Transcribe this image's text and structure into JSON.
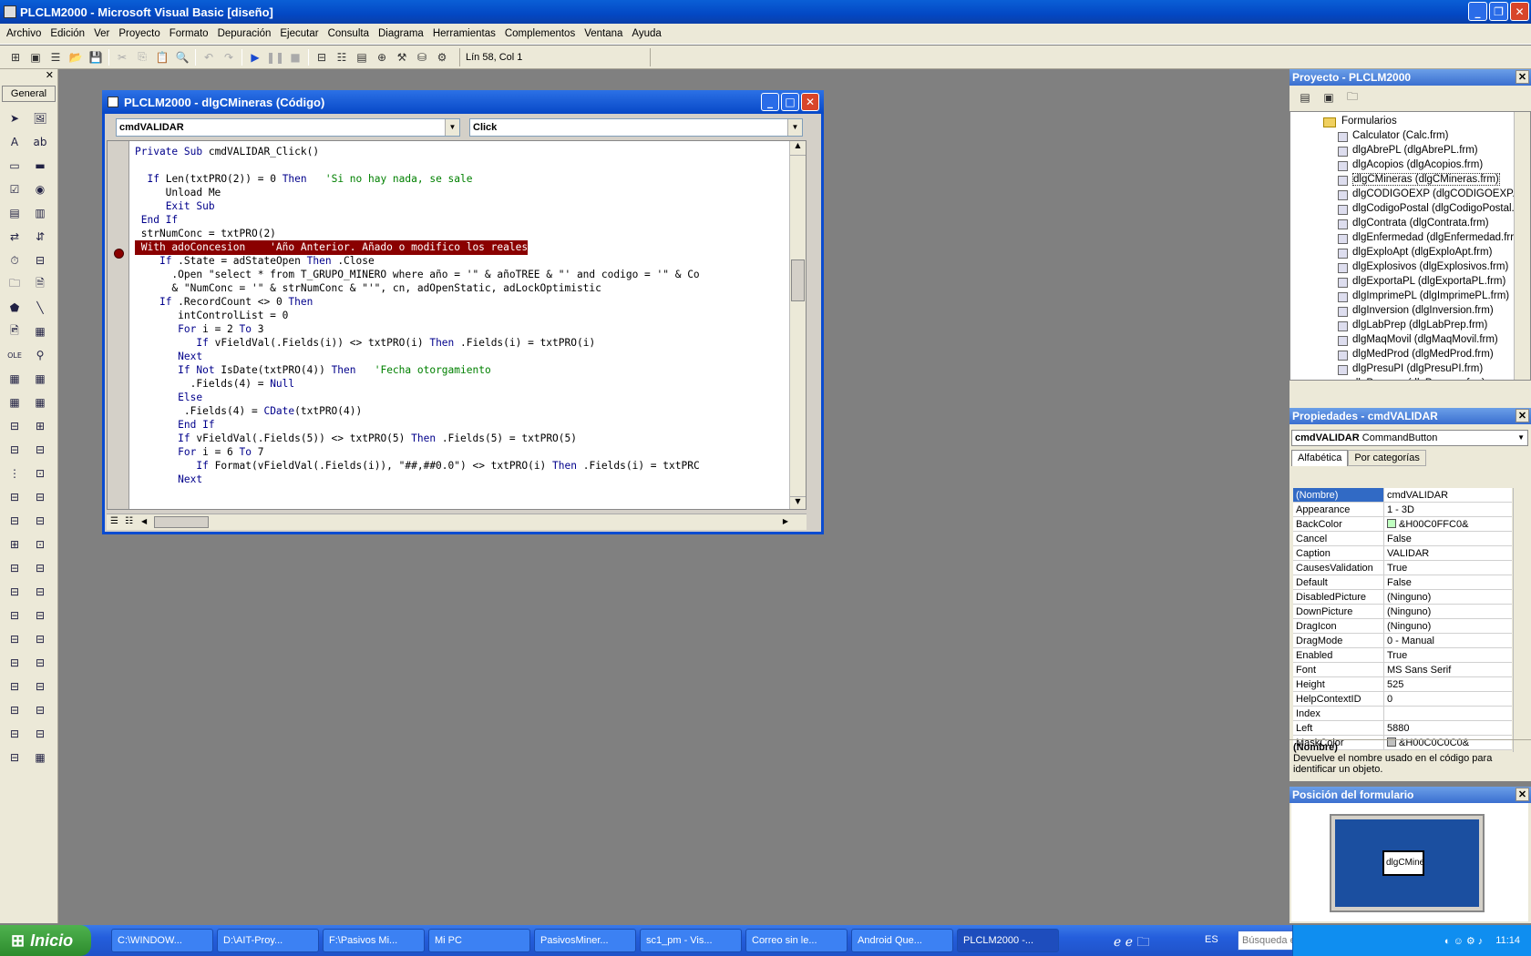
{
  "app": {
    "title": "PLCLM2000 - Microsoft Visual Basic [diseño]",
    "min": "_",
    "max": "❐",
    "close": "✕"
  },
  "menu": [
    "Archivo",
    "Edición",
    "Ver",
    "Proyecto",
    "Formato",
    "Depuración",
    "Ejecutar",
    "Consulta",
    "Diagrama",
    "Herramientas",
    "Complementos",
    "Ventana",
    "Ayuda"
  ],
  "toolbar": {
    "position": "Lín 58, Col 1"
  },
  "toolbox": {
    "title": "General",
    "close": "✕"
  },
  "code_window": {
    "title": "PLCLM2000 - dlgCMineras (Código)",
    "object_combo": "cmdVALIDAR",
    "proc_combo": "Click",
    "lines": [
      [
        [
          "kw",
          "Private Sub "
        ],
        [
          "",
          "cmdVALIDAR_Click()"
        ]
      ],
      [
        [
          "",
          ""
        ]
      ],
      [
        [
          "",
          "  "
        ],
        [
          "kw",
          "If "
        ],
        [
          "",
          "Len(txtPRO(2)) = 0 "
        ],
        [
          "kw",
          "Then"
        ],
        [
          "cm",
          "   'Si no hay nada, se sale"
        ]
      ],
      [
        [
          "",
          "     Unload Me"
        ]
      ],
      [
        [
          "",
          "     "
        ],
        [
          "kw",
          "Exit Sub"
        ]
      ],
      [
        [
          "kw",
          " End If"
        ]
      ],
      [
        [
          "",
          ""
        ],
        [
          "",
          ""
        ]
      ],
      [
        [
          "hl",
          " With adoConcesion    'Año Anterior. Añado o modifico los reales"
        ]
      ],
      [
        [
          "",
          "    "
        ],
        [
          "kw",
          "If "
        ],
        [
          "",
          ".State = adStateOpen "
        ],
        [
          "kw",
          "Then "
        ],
        [
          "",
          ".Close"
        ]
      ],
      [
        [
          "",
          "      .Open \"select * from T_GRUPO_MINERO where año = '\" & añoTREE & \"' and codigo = '\" & Co"
        ]
      ],
      [
        [
          "",
          "      & \"NumConc = '\" & strNumConc & \"'\", cn, adOpenStatic, adLockOptimistic"
        ]
      ],
      [
        [
          "",
          "    "
        ],
        [
          "kw",
          "If "
        ],
        [
          "",
          ".RecordCount <> 0 "
        ],
        [
          "kw",
          "Then"
        ]
      ],
      [
        [
          "",
          "       intControlList = 0"
        ]
      ],
      [
        [
          "",
          "       "
        ],
        [
          "kw",
          "For "
        ],
        [
          "",
          "i = 2 "
        ],
        [
          "kw",
          "To "
        ],
        [
          "",
          "3"
        ]
      ],
      [
        [
          "",
          "          "
        ],
        [
          "kw",
          "If "
        ],
        [
          "",
          "vFieldVal(.Fields(i)) <> txtPRO(i) "
        ],
        [
          "kw",
          "Then "
        ],
        [
          "",
          ".Fields(i) = txtPRO(i)"
        ]
      ],
      [
        [
          "kw",
          "       Next"
        ]
      ],
      [
        [
          "",
          "       "
        ],
        [
          "kw",
          "If Not "
        ],
        [
          "",
          "IsDate(txtPRO(4)) "
        ],
        [
          "kw",
          "Then"
        ],
        [
          "cm",
          "   'Fecha otorgamiento"
        ]
      ],
      [
        [
          "",
          "         .Fields(4) = "
        ],
        [
          "kw",
          "Null"
        ]
      ],
      [
        [
          "kw",
          "       Else"
        ]
      ],
      [
        [
          "",
          "        .Fields(4) = "
        ],
        [
          "kw",
          "CDate"
        ],
        [
          "",
          "(txtPRO(4))"
        ]
      ],
      [
        [
          "kw",
          "       End If"
        ]
      ],
      [
        [
          "",
          "       "
        ],
        [
          "kw",
          "If "
        ],
        [
          "",
          "vFieldVal(.Fields(5)) <> txtPRO(5) "
        ],
        [
          "kw",
          "Then "
        ],
        [
          "",
          ".Fields(5) = txtPRO(5)"
        ]
      ],
      [
        [
          "",
          "       "
        ],
        [
          "kw",
          "For "
        ],
        [
          "",
          "i = 6 "
        ],
        [
          "kw",
          "To "
        ],
        [
          "",
          "7"
        ]
      ],
      [
        [
          "",
          "          "
        ],
        [
          "kw",
          "If "
        ],
        [
          "",
          "Format(vFieldVal(.Fields(i)), \"##,##0.0\") <> txtPRO(i) "
        ],
        [
          "kw",
          "Then "
        ],
        [
          "",
          ".Fields(i) = txtPRC"
        ]
      ],
      [
        [
          "kw",
          "       Next"
        ]
      ]
    ],
    "line6": " strNumConc = txtPRO(2)"
  },
  "project": {
    "title": "Proyecto - PLCLM2000",
    "folder": "Formularios",
    "items": [
      "Calculator (Calc.frm)",
      "dlgAbrePL (dlgAbrePL.frm)",
      "dlgAcopios (dlgAcopios.frm)",
      "dlgCMineras (dlgCMineras.frm)",
      "dlgCODIGOEXP (dlgCODIGOEXP.fr",
      "dlgCodigoPostal (dlgCodigoPostal.f",
      "dlgContrata (dlgContrata.frm)",
      "dlgEnfermedad (dlgEnfermedad.frr",
      "dlgExploApt (dlgExploApt.frm)",
      "dlgExplosivos (dlgExplosivos.frm)",
      "dlgExportaPL (dlgExportaPL.frm)",
      "dlgImprimePL (dlgImprimePL.frm)",
      "dlgInversion (dlgInversion.frm)",
      "dlgLabPrep (dlgLabPrep.frm)",
      "dlgMaqMovil (dlgMaqMovil.frm)",
      "dlgMedProd (dlgMedProd.frm)",
      "dlgPresuPI (dlgPresuPI.frm)",
      "dlgProceso (dlgProceso.frm)"
    ],
    "selected": 3
  },
  "properties": {
    "title": "Propiedades - cmdVALIDAR",
    "object": "cmdVALIDAR",
    "type": "CommandButton",
    "tab_alpha": "Alfabética",
    "tab_cat": "Por categorías",
    "rows": [
      [
        "(Nombre)",
        "cmdVALIDAR"
      ],
      [
        "Appearance",
        "1 - 3D"
      ],
      [
        "BackColor",
        "&H00C0FFC0&"
      ],
      [
        "Cancel",
        "False"
      ],
      [
        "Caption",
        "VALIDAR"
      ],
      [
        "CausesValidation",
        "True"
      ],
      [
        "Default",
        "False"
      ],
      [
        "DisabledPicture",
        "(Ninguno)"
      ],
      [
        "DownPicture",
        "(Ninguno)"
      ],
      [
        "DragIcon",
        "(Ninguno)"
      ],
      [
        "DragMode",
        "0 - Manual"
      ],
      [
        "Enabled",
        "True"
      ],
      [
        "Font",
        "MS Sans Serif"
      ],
      [
        "Height",
        "525"
      ],
      [
        "HelpContextID",
        "0"
      ],
      [
        "Index",
        ""
      ],
      [
        "Left",
        "5880"
      ],
      [
        "MaskColor",
        "&H00C0C0C0&"
      ]
    ],
    "desc_title": "(Nombre)",
    "desc": "Devuelve el nombre usado en el código para identificar un objeto."
  },
  "layout_win": {
    "title": "Posición del formulario",
    "form_label": "dlgCMine"
  },
  "taskbar": {
    "start": "Inicio",
    "buttons": [
      "C:\\WINDOW...",
      "D:\\AIT-Proy...",
      "F:\\Pasivos Mi...",
      "Mi PC",
      "PasivosMiner...",
      "sc1_pm - Vis...",
      "Correo sin le...",
      "Android Que...",
      "PLCLM2000 -..."
    ],
    "active": 8,
    "lang": "ES",
    "search": "Búsqueda en el escritorio",
    "time": "11:14"
  },
  "colors": {
    "highlight": "#8a0000",
    "keyword": "#00008b",
    "comment": "#008000",
    "backcolor_swatch": "#c0ffc0",
    "maskcolor_swatch": "#c0c0c0"
  }
}
